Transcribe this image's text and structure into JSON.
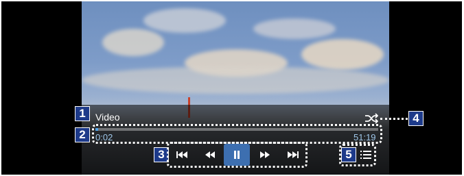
{
  "player": {
    "title": "Video",
    "elapsed": "0:02",
    "duration": "51:19",
    "progress_fraction": 0.0007
  },
  "callouts": {
    "one": "1",
    "two": "2",
    "three": "3",
    "four": "4",
    "five": "5"
  },
  "controls": {
    "skip_previous": "skip-previous-icon",
    "rewind": "rewind-icon",
    "pause": "pause-icon",
    "fast_forward": "fast-forward-icon",
    "skip_next": "skip-next-icon",
    "shuffle": "shuffle-icon",
    "playlist": "playlist-icon"
  },
  "colors": {
    "callout_bg": "#1d3a8a",
    "progress": "#4fa3e8",
    "active_button": "#3d6fb0"
  }
}
